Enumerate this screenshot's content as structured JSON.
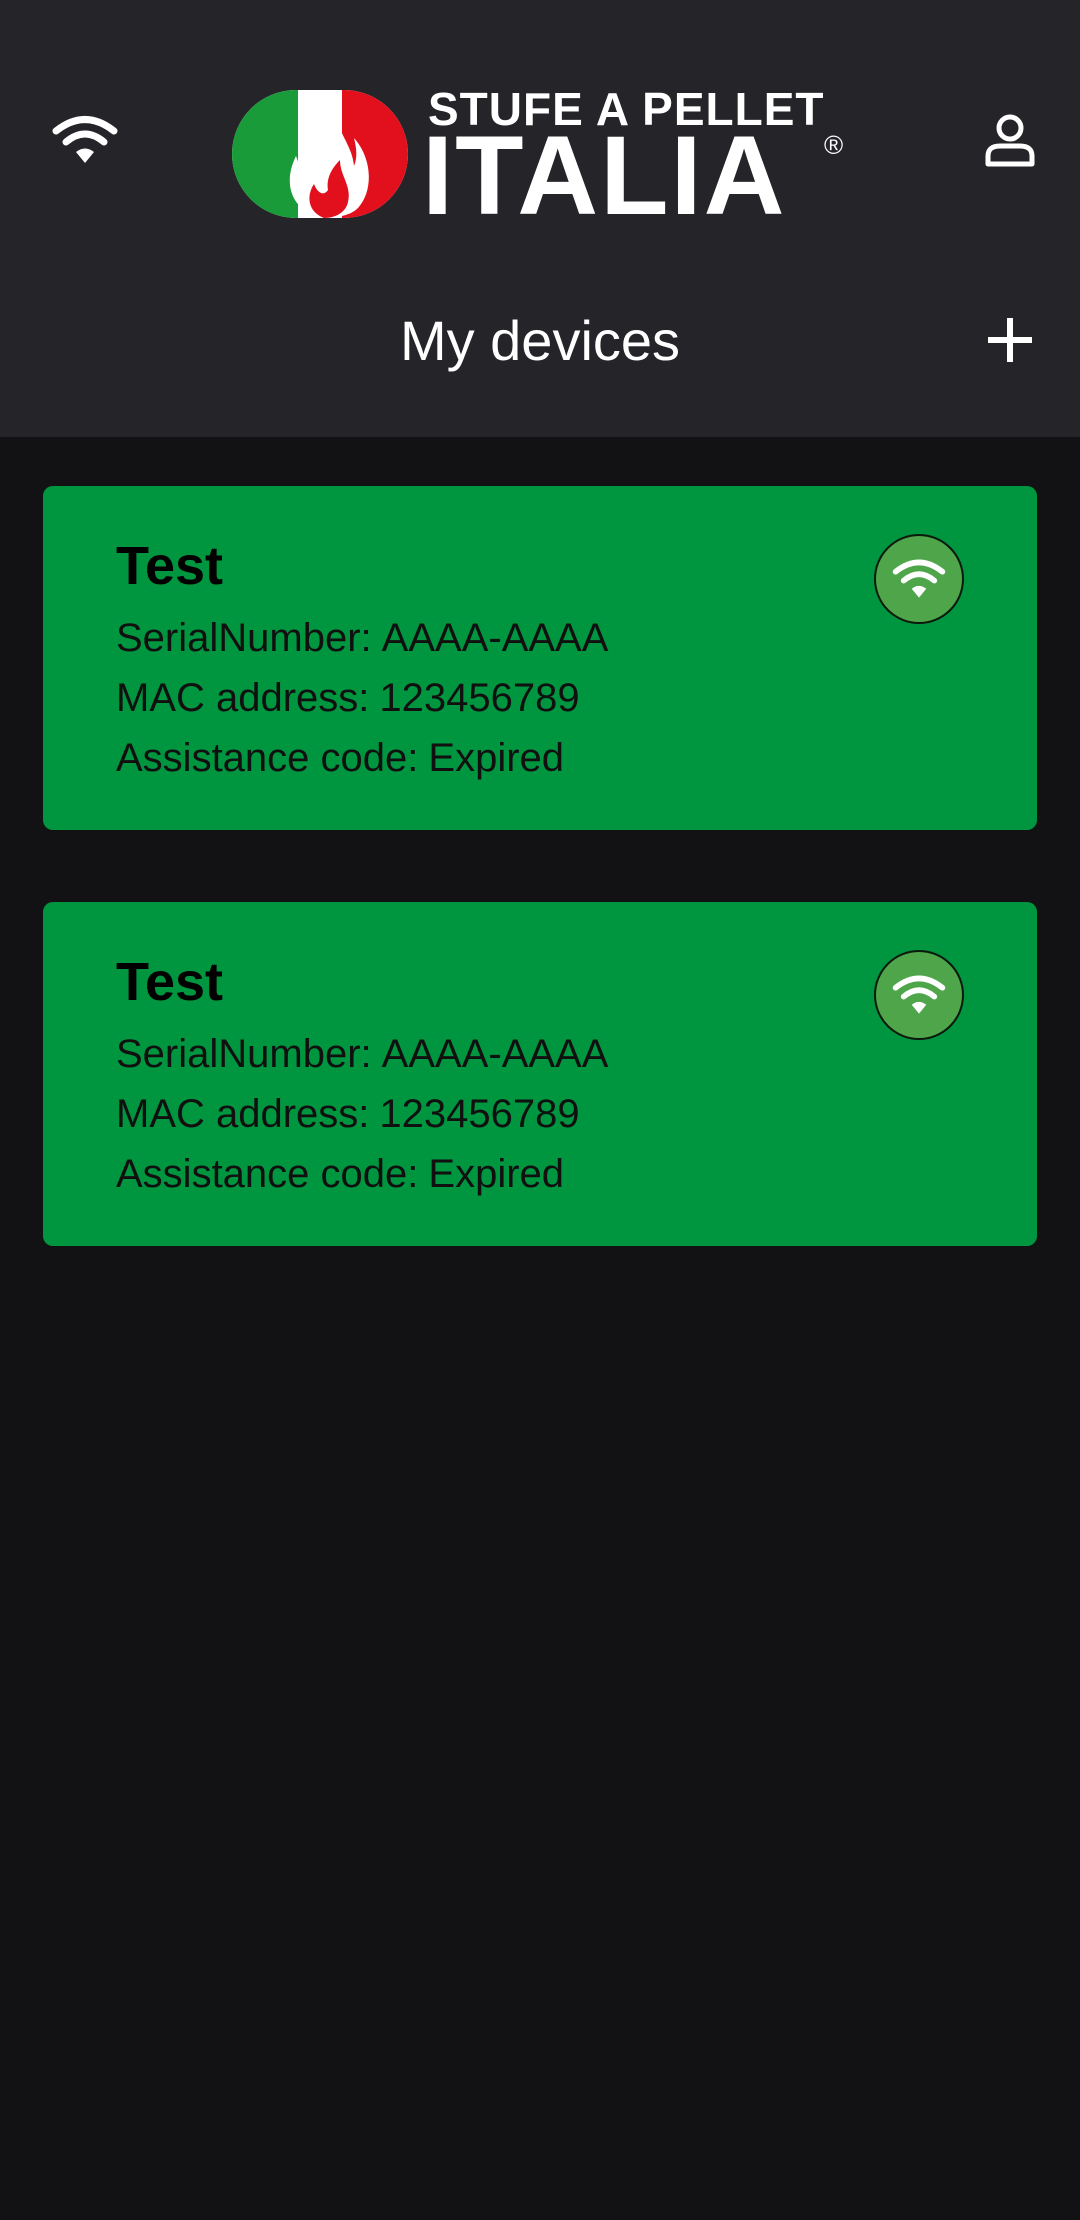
{
  "header": {
    "logo": {
      "top_text": "STUFE A PELLET",
      "main_text": "ITALIA",
      "registered_mark": "®"
    },
    "title": "My devices",
    "icons": {
      "left": "wifi-icon",
      "right": "user-icon",
      "add": "plus-icon"
    }
  },
  "devices": [
    {
      "name": "Test",
      "serial_label": "SerialNumber:",
      "serial": "AAAA-AAAA",
      "mac_label": "MAC address:",
      "mac": "123456789",
      "assist_label": "Assistance code:",
      "assist": "Expired",
      "status_icon": "wifi-connected-icon"
    },
    {
      "name": "Test",
      "serial_label": "SerialNumber:",
      "serial": "AAAA-AAAA",
      "mac_label": "MAC address:",
      "mac": "123456789",
      "assist_label": "Assistance code:",
      "assist": "Expired",
      "status_icon": "wifi-connected-icon"
    }
  ],
  "colors": {
    "background": "#121114",
    "header": "#252429",
    "card": "#00953f",
    "status_circle": "#4ea54a",
    "logo_green": "#1a9b3a",
    "logo_red": "#e2101c"
  }
}
